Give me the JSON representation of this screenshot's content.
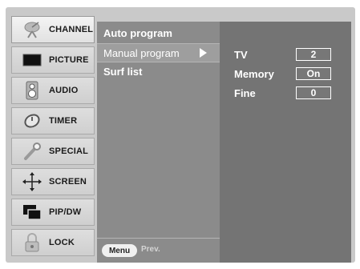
{
  "sidebar": {
    "items": [
      {
        "label": "CHANNEL",
        "icon": "satellite-dish-icon",
        "active": true
      },
      {
        "label": "PICTURE",
        "icon": "monitor-icon",
        "active": false
      },
      {
        "label": "AUDIO",
        "icon": "speaker-icon",
        "active": false
      },
      {
        "label": "TIMER",
        "icon": "clock-icon",
        "active": false
      },
      {
        "label": "SPECIAL",
        "icon": "wrench-icon",
        "active": false
      },
      {
        "label": "SCREEN",
        "icon": "move-arrows-icon",
        "active": false
      },
      {
        "label": "PIP/DW",
        "icon": "pip-windows-icon",
        "active": false
      },
      {
        "label": "LOCK",
        "icon": "padlock-icon",
        "active": false
      }
    ]
  },
  "menu": {
    "items": [
      {
        "label": "Auto program"
      },
      {
        "label": "Manual program"
      },
      {
        "label": "Surf list"
      }
    ],
    "footer": {
      "menu_button": "Menu",
      "prev_label": "Prev."
    }
  },
  "panel": {
    "rows": [
      {
        "label": "TV",
        "value": "2"
      },
      {
        "label": "Memory",
        "value": "On"
      },
      {
        "label": "Fine",
        "value": "0"
      }
    ]
  }
}
